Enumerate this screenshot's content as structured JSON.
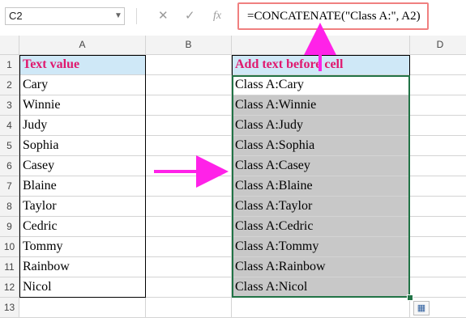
{
  "formula_bar": {
    "name_box": "C2",
    "cancel_icon": "cancel-icon",
    "enter_icon": "enter-icon",
    "fx_label": "fx",
    "formula": "=CONCATENATE(\"Class A:\", A2)"
  },
  "columns": [
    "A",
    "B",
    "C",
    "D"
  ],
  "rows": [
    "1",
    "2",
    "3",
    "4",
    "5",
    "6",
    "7",
    "8",
    "9",
    "10",
    "11",
    "12",
    "13"
  ],
  "column_a": {
    "header": "Text value",
    "values": [
      "Cary",
      "Winnie",
      "Judy",
      "Sophia",
      "Casey",
      "Blaine",
      "Taylor",
      "Cedric",
      "Tommy",
      "Rainbow",
      "Nicol"
    ]
  },
  "column_c": {
    "header": "Add text before cell",
    "values": [
      "Class A:Cary",
      "Class A:Winnie",
      "Class A:Judy",
      "Class A:Sophia",
      "Class A:Casey",
      "Class A:Blaine",
      "Class A:Taylor",
      "Class A:Cedric",
      "Class A:Tommy",
      "Class A:Rainbow",
      "Class A:Nicol"
    ]
  },
  "colors": {
    "arrow": "#ff22e8",
    "header_text": "#e0186e",
    "header_fill": "#cfe8f7",
    "selection": "#217346"
  }
}
